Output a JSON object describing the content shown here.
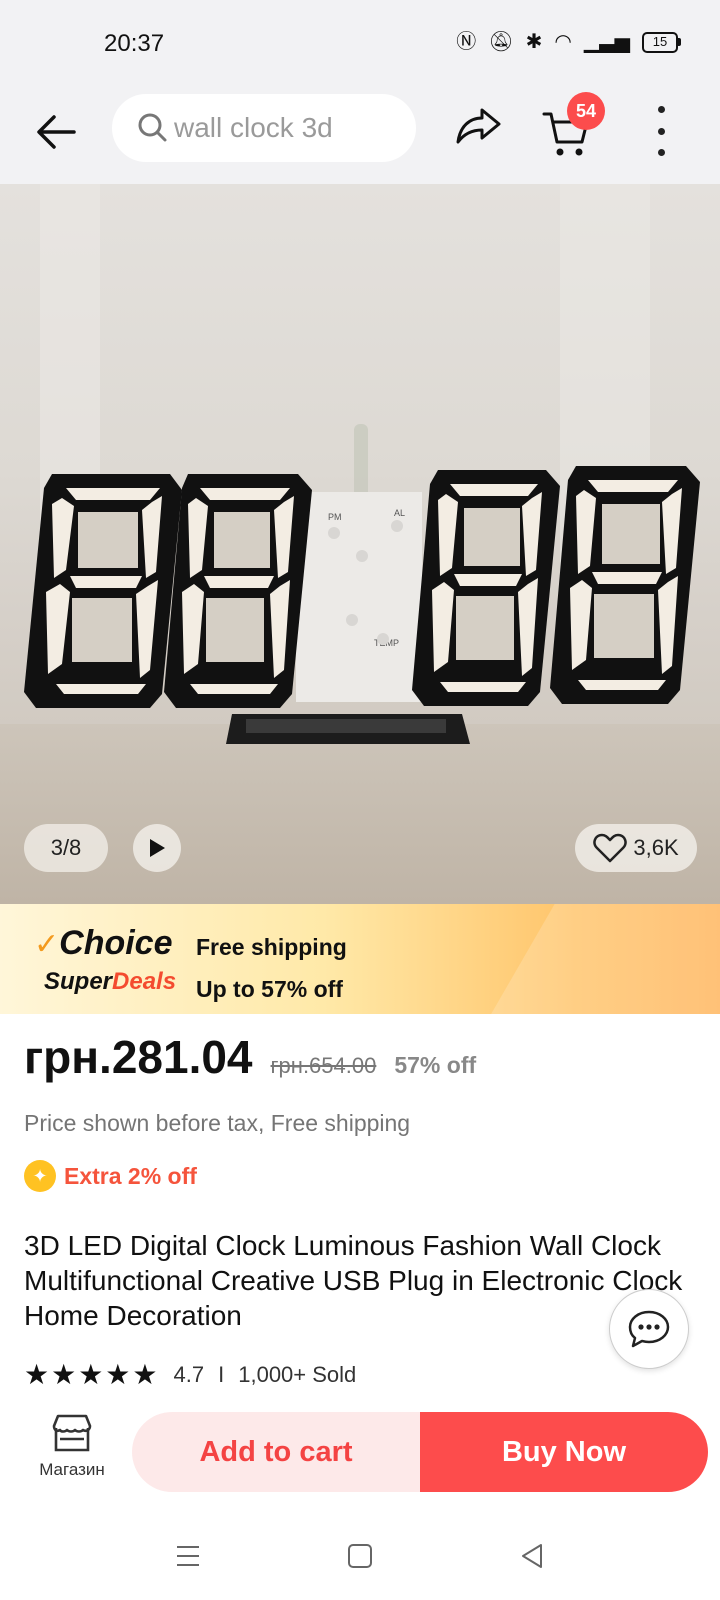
{
  "status_bar": {
    "time": "20:37",
    "battery": "15"
  },
  "header": {
    "search_placeholder": "wall clock 3d",
    "cart_count": "54"
  },
  "gallery": {
    "photo_counter": "3/8",
    "wishlist_count": "3,6K",
    "clock_labels": {
      "pm": "PM",
      "al": "AL",
      "temp": "TEMP"
    }
  },
  "choice_banner": {
    "brand": "Choice",
    "super": "Super",
    "deals": "Deals",
    "line1": "Free shipping",
    "line2": "Up to 57% off"
  },
  "price": {
    "current": "грн.281.04",
    "original": "грн.654.00",
    "discount": "57% off",
    "tax_note": "Price shown before tax, Free shipping",
    "extra": "Extra 2% off"
  },
  "product": {
    "title": "3D LED Digital Clock Luminous Fashion Wall Clock Multifunctional Creative USB Plug in Electronic Clock Home Decoration",
    "rating": "4.7",
    "separator": "I",
    "sold": "1,000+ Sold"
  },
  "actions": {
    "store_label": "Магазин",
    "add_to_cart": "Add to cart",
    "buy_now": "Buy Now"
  },
  "icons": [
    "back-arrow-icon",
    "search-icon",
    "share-icon",
    "cart-icon",
    "more-icon",
    "play-icon",
    "heart-icon",
    "sparkle-icon",
    "star-icon",
    "chat-icon",
    "store-icon",
    "menu-icon",
    "home-icon",
    "back-icon"
  ],
  "colors": {
    "accent": "#fd4c4c",
    "cart_bg": "#fde9e9",
    "banner_gold": "#ffc46a"
  }
}
